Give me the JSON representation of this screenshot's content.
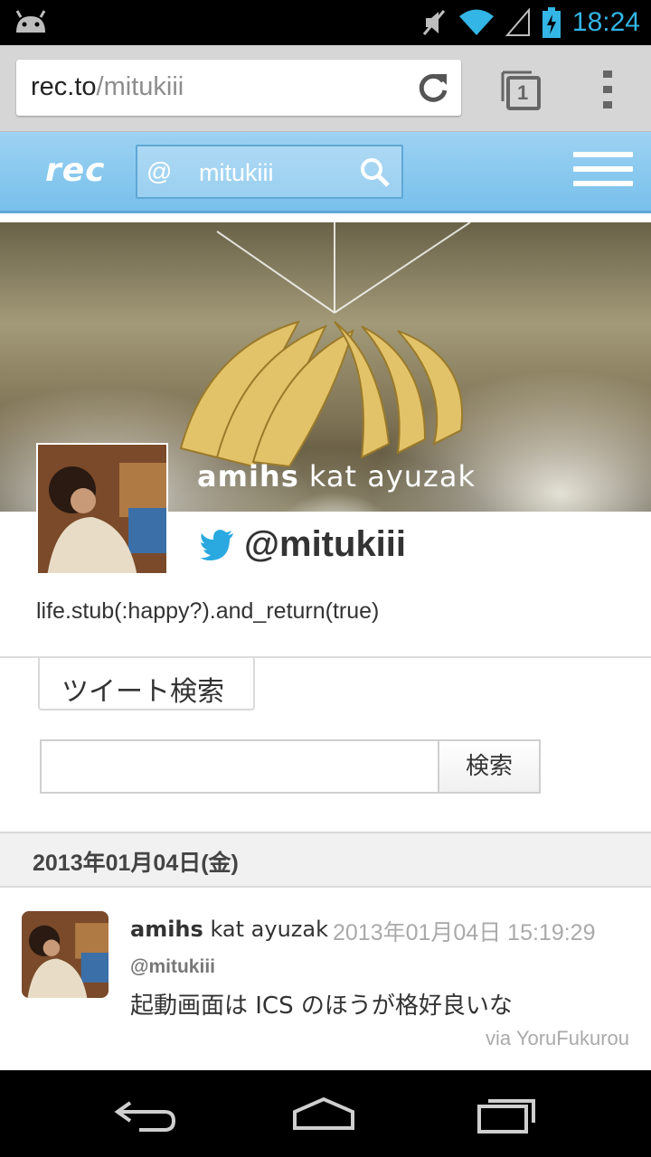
{
  "status_bar": {
    "time": "18:24",
    "icons": [
      "android-icon",
      "mute-icon",
      "wifi-icon",
      "signal-icon",
      "battery-charging-icon"
    ]
  },
  "browser": {
    "url_domain": "rec.to",
    "url_path": "/mitukiii",
    "tab_count": "1",
    "icons": [
      "reload-icon",
      "tabs-icon",
      "overflow-menu-icon"
    ]
  },
  "site_header": {
    "logo": "rec",
    "search_prefix": "@",
    "search_value": "mitukiii",
    "accent_color": "#78c0ec"
  },
  "profile": {
    "banner_name_bold": "amihs",
    "banner_name_rest": " kat ayuzak",
    "handle": "@mitukiii",
    "bio": "life.stub(:happy?).and_return(true)"
  },
  "tweet_search": {
    "tab_label": "ツイート検索",
    "input_value": "",
    "button_label": "検索"
  },
  "timeline": {
    "date_header": "2013年01月04日(金)",
    "tweets": [
      {
        "name_bold": "amihs",
        "name_rest": " kat ayuzak",
        "timestamp": "2013年01月04日 15:19:29",
        "handle": "@mitukiii",
        "text": "起動画面は ICS のほうが格好良いな",
        "via": "via YoruFukurou"
      }
    ]
  },
  "nav_bar": {
    "icons": [
      "back-icon",
      "home-icon",
      "recent-apps-icon"
    ]
  }
}
